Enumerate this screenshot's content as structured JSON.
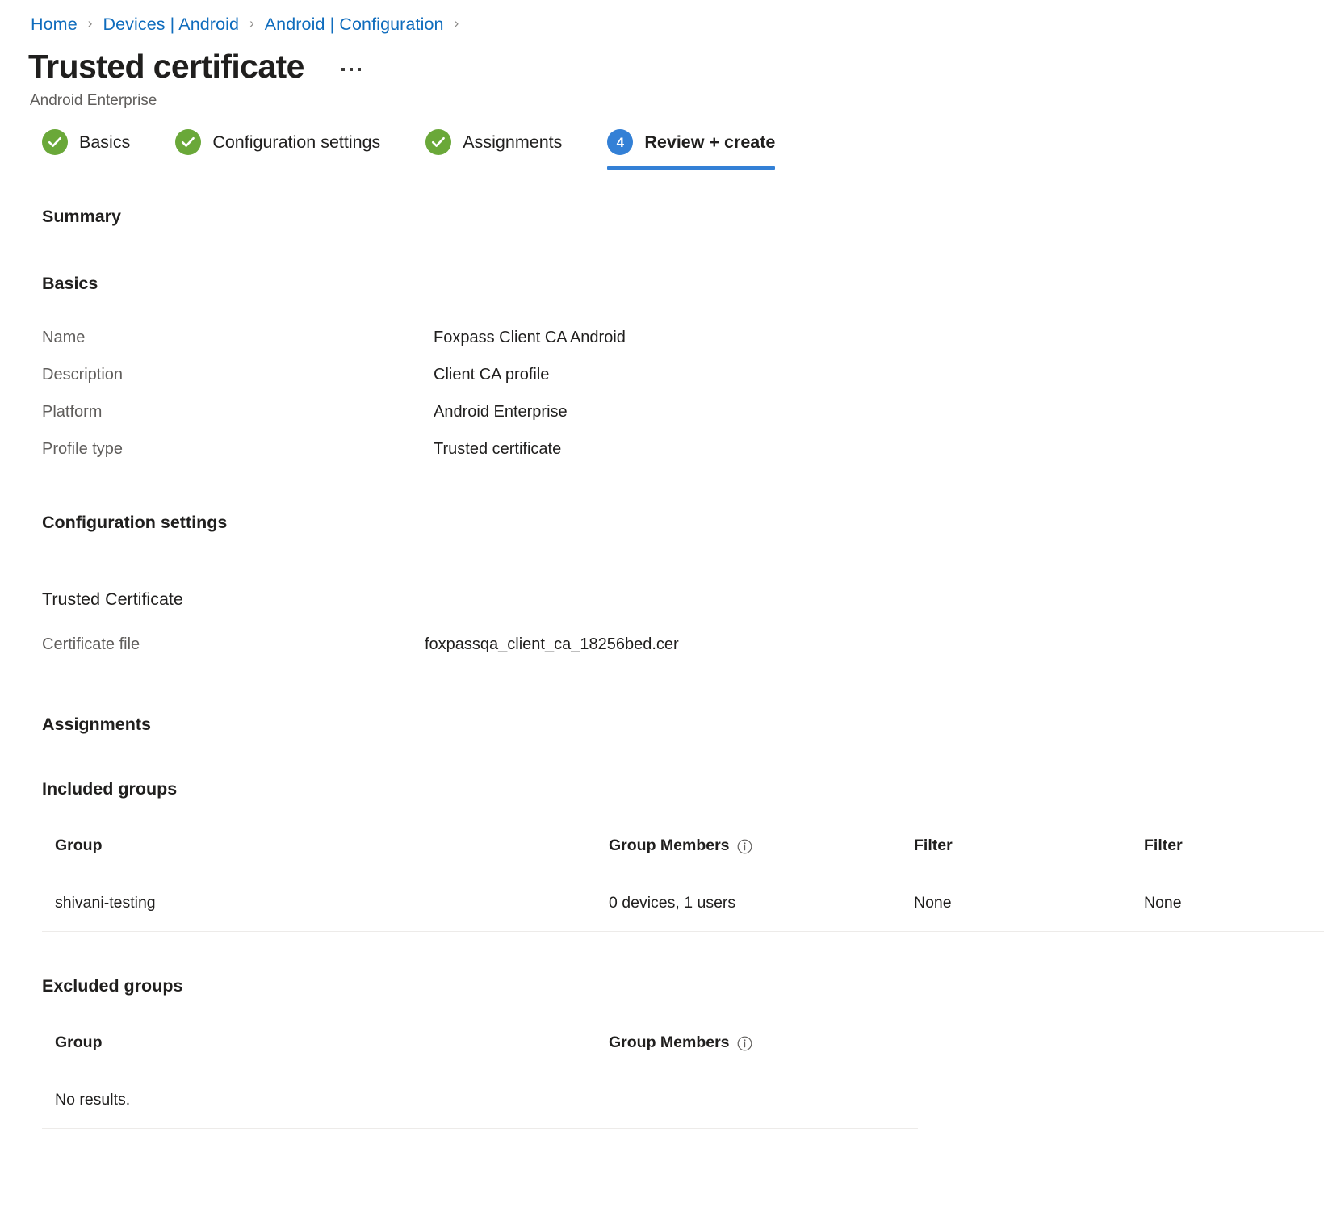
{
  "breadcrumb": {
    "items": [
      {
        "label": "Home"
      },
      {
        "label": "Devices | Android"
      },
      {
        "label": "Android | Configuration"
      }
    ],
    "separator": "›"
  },
  "header": {
    "title": "Trusted certificate",
    "subtitle": "Android Enterprise",
    "more_menu": "more-actions"
  },
  "wizard": {
    "tabs": [
      {
        "label": "Basics",
        "state": "done",
        "badge": "✓"
      },
      {
        "label": "Configuration settings",
        "state": "done",
        "badge": "✓"
      },
      {
        "label": "Assignments",
        "state": "done",
        "badge": "✓"
      },
      {
        "label": "Review + create",
        "state": "active",
        "badge": "4"
      }
    ]
  },
  "summary": {
    "heading": "Summary",
    "basics": {
      "heading": "Basics",
      "rows": [
        {
          "key": "Name",
          "value": "Foxpass Client CA Android"
        },
        {
          "key": "Description",
          "value": "Client CA profile"
        },
        {
          "key": "Platform",
          "value": "Android Enterprise"
        },
        {
          "key": "Profile type",
          "value": "Trusted certificate"
        }
      ]
    },
    "configuration_settings": {
      "heading": "Configuration settings",
      "subheading": "Trusted Certificate",
      "rows": [
        {
          "key": "Certificate file",
          "value": "foxpassqa_client_ca_18256bed.cer"
        }
      ]
    },
    "assignments": {
      "heading": "Assignments",
      "included": {
        "heading": "Included groups",
        "columns": [
          "Group",
          "Group Members",
          "Filter",
          "Filter"
        ],
        "members_info_tooltip": "info-icon",
        "rows": [
          {
            "group": "shivani-testing",
            "members": "0 devices, 1 users",
            "filter": "None",
            "filter_mode": "None"
          }
        ]
      },
      "excluded": {
        "heading": "Excluded groups",
        "columns": [
          "Group",
          "Group Members"
        ],
        "empty_text": "No results.",
        "rows": []
      }
    }
  },
  "colors": {
    "link": "#0f6cbd",
    "tab_done": "#6aa839",
    "tab_active": "#3380d6",
    "text_primary": "#201f1e",
    "text_secondary": "#605e5c",
    "divider": "#edebe9"
  }
}
